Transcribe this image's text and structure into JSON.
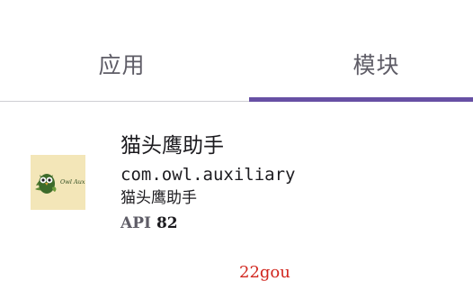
{
  "tabs": [
    {
      "label": "应用",
      "selected": false
    },
    {
      "label": "模块",
      "selected": true
    }
  ],
  "colors": {
    "indicator": "#6750a4",
    "tab_text": "#5e5c66",
    "watermark": "#d1261e",
    "icon_bg": "#f3e6b8"
  },
  "module": {
    "icon": "owl-auxiliary-icon",
    "icon_text": "Owl Auxiliary",
    "title": "猫头鹰助手",
    "package": "com.owl.auxiliary",
    "description": "猫头鹰助手",
    "api_label": "API",
    "api_value": "82"
  },
  "watermark": "22gou"
}
